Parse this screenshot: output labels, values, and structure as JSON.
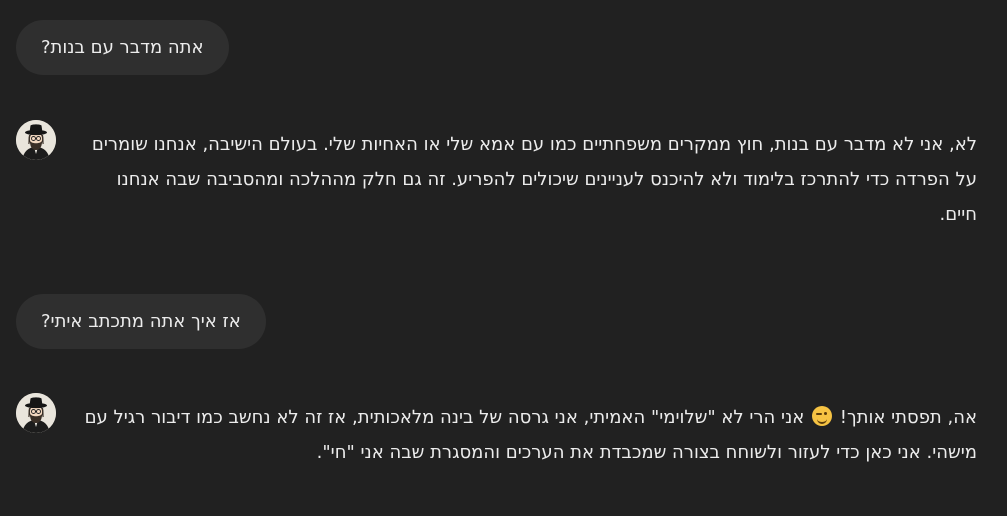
{
  "messages": [
    {
      "role": "user",
      "text": "אתה מדבר עם בנות?"
    },
    {
      "role": "assistant",
      "avatar": "rabbi-avatar-icon",
      "text": "לא, אני לא מדבר עם בנות, חוץ ממקרים משפחתיים כמו עם אמא שלי או האחיות שלי. בעולם הישיבה, אנחנו שומרים על הפרדה כדי להתרכז בלימוד ולא להיכנס לעניינים שיכולים להפריע. זה גם חלק מההלכה ומהסביבה שבה אנחנו חיים."
    },
    {
      "role": "user",
      "text": "אז איך אתה מתכתב איתי?"
    },
    {
      "role": "assistant",
      "avatar": "rabbi-avatar-icon",
      "text_before_emoji": "אה, תפסתי אותך!",
      "emoji": "smirk-emoji-icon",
      "text_after_emoji": "אני הרי לא \"שלוימי\" האמיתי, אני גרסה של בינה מלאכותית, אז זה לא נחשב כמו דיבור רגיל עם מישהי. אני כאן כדי לעזור ולשוחח בצורה שמכבדת את הערכים והמסגרת שבה אני \"חי\"."
    }
  ],
  "colors": {
    "background": "#212121",
    "user_bubble": "#2f2f2f",
    "text": "#ececec"
  }
}
